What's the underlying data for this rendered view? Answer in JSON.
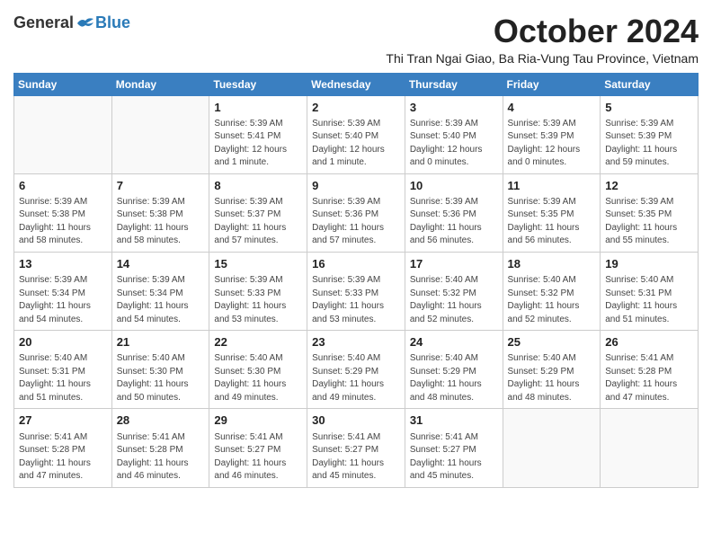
{
  "logo": {
    "general": "General",
    "blue": "Blue"
  },
  "title": "October 2024",
  "subtitle": "Thi Tran Ngai Giao, Ba Ria-Vung Tau Province, Vietnam",
  "days_of_week": [
    "Sunday",
    "Monday",
    "Tuesday",
    "Wednesday",
    "Thursday",
    "Friday",
    "Saturday"
  ],
  "weeks": [
    [
      {
        "day": "",
        "info": ""
      },
      {
        "day": "",
        "info": ""
      },
      {
        "day": "1",
        "info": "Sunrise: 5:39 AM\nSunset: 5:41 PM\nDaylight: 12 hours\nand 1 minute."
      },
      {
        "day": "2",
        "info": "Sunrise: 5:39 AM\nSunset: 5:40 PM\nDaylight: 12 hours\nand 1 minute."
      },
      {
        "day": "3",
        "info": "Sunrise: 5:39 AM\nSunset: 5:40 PM\nDaylight: 12 hours\nand 0 minutes."
      },
      {
        "day": "4",
        "info": "Sunrise: 5:39 AM\nSunset: 5:39 PM\nDaylight: 12 hours\nand 0 minutes."
      },
      {
        "day": "5",
        "info": "Sunrise: 5:39 AM\nSunset: 5:39 PM\nDaylight: 11 hours\nand 59 minutes."
      }
    ],
    [
      {
        "day": "6",
        "info": "Sunrise: 5:39 AM\nSunset: 5:38 PM\nDaylight: 11 hours\nand 58 minutes."
      },
      {
        "day": "7",
        "info": "Sunrise: 5:39 AM\nSunset: 5:38 PM\nDaylight: 11 hours\nand 58 minutes."
      },
      {
        "day": "8",
        "info": "Sunrise: 5:39 AM\nSunset: 5:37 PM\nDaylight: 11 hours\nand 57 minutes."
      },
      {
        "day": "9",
        "info": "Sunrise: 5:39 AM\nSunset: 5:36 PM\nDaylight: 11 hours\nand 57 minutes."
      },
      {
        "day": "10",
        "info": "Sunrise: 5:39 AM\nSunset: 5:36 PM\nDaylight: 11 hours\nand 56 minutes."
      },
      {
        "day": "11",
        "info": "Sunrise: 5:39 AM\nSunset: 5:35 PM\nDaylight: 11 hours\nand 56 minutes."
      },
      {
        "day": "12",
        "info": "Sunrise: 5:39 AM\nSunset: 5:35 PM\nDaylight: 11 hours\nand 55 minutes."
      }
    ],
    [
      {
        "day": "13",
        "info": "Sunrise: 5:39 AM\nSunset: 5:34 PM\nDaylight: 11 hours\nand 54 minutes."
      },
      {
        "day": "14",
        "info": "Sunrise: 5:39 AM\nSunset: 5:34 PM\nDaylight: 11 hours\nand 54 minutes."
      },
      {
        "day": "15",
        "info": "Sunrise: 5:39 AM\nSunset: 5:33 PM\nDaylight: 11 hours\nand 53 minutes."
      },
      {
        "day": "16",
        "info": "Sunrise: 5:39 AM\nSunset: 5:33 PM\nDaylight: 11 hours\nand 53 minutes."
      },
      {
        "day": "17",
        "info": "Sunrise: 5:40 AM\nSunset: 5:32 PM\nDaylight: 11 hours\nand 52 minutes."
      },
      {
        "day": "18",
        "info": "Sunrise: 5:40 AM\nSunset: 5:32 PM\nDaylight: 11 hours\nand 52 minutes."
      },
      {
        "day": "19",
        "info": "Sunrise: 5:40 AM\nSunset: 5:31 PM\nDaylight: 11 hours\nand 51 minutes."
      }
    ],
    [
      {
        "day": "20",
        "info": "Sunrise: 5:40 AM\nSunset: 5:31 PM\nDaylight: 11 hours\nand 51 minutes."
      },
      {
        "day": "21",
        "info": "Sunrise: 5:40 AM\nSunset: 5:30 PM\nDaylight: 11 hours\nand 50 minutes."
      },
      {
        "day": "22",
        "info": "Sunrise: 5:40 AM\nSunset: 5:30 PM\nDaylight: 11 hours\nand 49 minutes."
      },
      {
        "day": "23",
        "info": "Sunrise: 5:40 AM\nSunset: 5:29 PM\nDaylight: 11 hours\nand 49 minutes."
      },
      {
        "day": "24",
        "info": "Sunrise: 5:40 AM\nSunset: 5:29 PM\nDaylight: 11 hours\nand 48 minutes."
      },
      {
        "day": "25",
        "info": "Sunrise: 5:40 AM\nSunset: 5:29 PM\nDaylight: 11 hours\nand 48 minutes."
      },
      {
        "day": "26",
        "info": "Sunrise: 5:41 AM\nSunset: 5:28 PM\nDaylight: 11 hours\nand 47 minutes."
      }
    ],
    [
      {
        "day": "27",
        "info": "Sunrise: 5:41 AM\nSunset: 5:28 PM\nDaylight: 11 hours\nand 47 minutes."
      },
      {
        "day": "28",
        "info": "Sunrise: 5:41 AM\nSunset: 5:28 PM\nDaylight: 11 hours\nand 46 minutes."
      },
      {
        "day": "29",
        "info": "Sunrise: 5:41 AM\nSunset: 5:27 PM\nDaylight: 11 hours\nand 46 minutes."
      },
      {
        "day": "30",
        "info": "Sunrise: 5:41 AM\nSunset: 5:27 PM\nDaylight: 11 hours\nand 45 minutes."
      },
      {
        "day": "31",
        "info": "Sunrise: 5:41 AM\nSunset: 5:27 PM\nDaylight: 11 hours\nand 45 minutes."
      },
      {
        "day": "",
        "info": ""
      },
      {
        "day": "",
        "info": ""
      }
    ]
  ]
}
